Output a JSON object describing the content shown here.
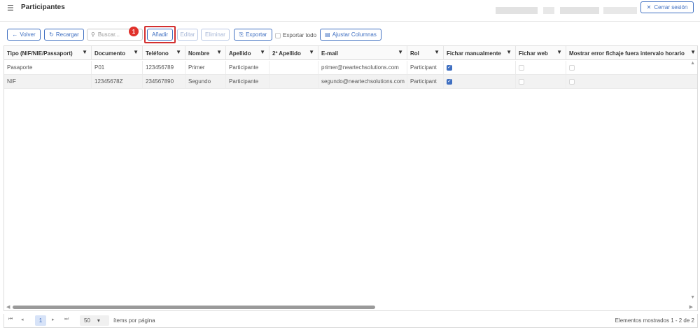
{
  "header": {
    "menu_icon": "☰",
    "title": "Participantes",
    "logout_icon": "✕",
    "logout_label": "Cerrar sesión"
  },
  "toolbar": {
    "back_icon": "←",
    "back_label": "Volver",
    "reload_icon": "↻",
    "reload_label": "Recargar",
    "search_icon": "⚲",
    "search_placeholder": "Buscar...",
    "step_badge": "1",
    "add_label": "Añadir",
    "edit_label": "Editar",
    "delete_label": "Eliminar",
    "export_icon": "⎘",
    "export_label": "Exportar",
    "export_all_label": "Exportar todo",
    "adjust_icon": "▤",
    "adjust_columns_label": "Ajustar Columnas"
  },
  "grid": {
    "filter_icon": "▼",
    "columns": [
      "Tipo (NIF/NIE/Passaport)",
      "Documento",
      "Teléfono",
      "Nombre",
      "Apellido",
      "2º Apellido",
      "E-mail",
      "Rol",
      "Fichar manualmente",
      "Fichar web",
      "Mostrar error fichaje fuera intervalo horario"
    ],
    "rows": [
      {
        "tipo": "Pasaporte",
        "documento": "P01",
        "telefono": "123456789",
        "nombre": "Primer",
        "apellido": "Participante",
        "apellido2": "",
        "email": "primer@neartechsolutions.com",
        "rol": "Participant",
        "fichar_manualmente": true,
        "fichar_web": false,
        "mostrar_error": false
      },
      {
        "tipo": "NIF",
        "documento": "12345678Z",
        "telefono": "234567890",
        "nombre": "Segundo",
        "apellido": "Participante",
        "apellido2": "",
        "email": "segundo@neartechsolutions.com",
        "rol": "Participant",
        "fichar_manualmente": true,
        "fichar_web": false,
        "mostrar_error": false
      }
    ],
    "check_mark": "✓"
  },
  "pager": {
    "first_icon": "⏮",
    "prev_icon": "◂",
    "current_page": "1",
    "next_icon": "▸",
    "last_icon": "⏭",
    "page_size": "50",
    "page_size_caret": "▾",
    "per_page_label": "ítems por página",
    "shown_info": "Elementos mostrados 1 - 2 de 2"
  },
  "colors": {
    "accent": "#3f6fc1",
    "highlight": "#d32f2f",
    "badge": "#e0312b"
  }
}
